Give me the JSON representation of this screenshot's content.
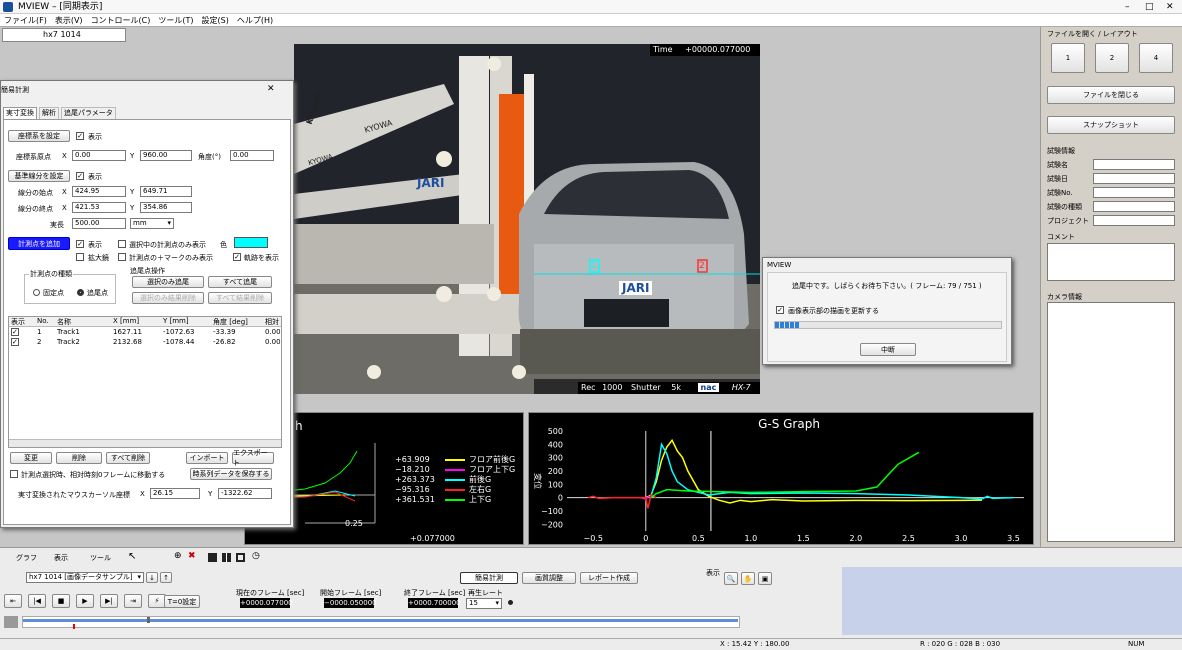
{
  "window": {
    "app": "MVIEW",
    "title": "MVIEW  –  [同期表示]",
    "min": "–",
    "max": "□",
    "close": "✕"
  },
  "menu": [
    "ファイル(F)",
    "表示(V)",
    "コントロール(C)",
    "ツール(T)",
    "設定(S)",
    "ヘルプ(H)"
  ],
  "tab": {
    "label": "hx7 1014"
  },
  "video": {
    "time_label": "Time",
    "time_value": "+00000.077000",
    "rec_label": "Rec",
    "rec_value": "1000",
    "shutter_label": "Shutter",
    "shutter_value": "5k",
    "brand": "nac",
    "model": "HX-7",
    "track_markers": [
      "1",
      "2"
    ],
    "plate": "JARI",
    "sign": "JARI",
    "kyowa": "KYOWA",
    "kyowa2": "KYOWA",
    "kyowa3": "KYOWA"
  },
  "right_panel": {
    "open_layout_title": "ファイルを開く / レイアウト",
    "layout_buttons": [
      "1",
      "2",
      "4"
    ],
    "close_file": "ファイルを閉じる",
    "snapshot": "スナップショット",
    "test_info_title": "試験情報",
    "test_info_fields": [
      "試験名",
      "試験日",
      "試験No.",
      "試験の種類",
      "プロジェクト"
    ],
    "comment": "コメント",
    "camera_info_title": "カメラ情報"
  },
  "progress_dialog": {
    "title": "MVIEW",
    "message": "追尾中です。しばらくお待ち下さい。( フレーム: 79 / 751 )",
    "checkbox": "画像表示部の描画を更新する",
    "checked": "✓",
    "cancel": "中断",
    "progress": 0.105
  },
  "measure_panel": {
    "title": "簡易計測",
    "close": "✕",
    "tabs": [
      "実寸変換",
      "解析",
      "追尾パラメータ"
    ],
    "coord_btn": "座標系を設定",
    "show": "表示",
    "origin_label": "座標系原点",
    "x": "X",
    "y": "Y",
    "origin_x": "0.00",
    "origin_y": "960.00",
    "angle_label": "角度(°)",
    "angle": "0.00",
    "ref_btn": "基準線分を設定",
    "seg_start": "線分の始点",
    "seg_start_x": "424.95",
    "seg_start_y": "649.71",
    "seg_end": "線分の終点",
    "seg_end_x": "421.53",
    "seg_end_y": "354.86",
    "length_label": "実長",
    "length": "500.00",
    "unit": "mm",
    "add_point_btn": "計測点を追加",
    "sel_only": "選択中の計測点のみ表示",
    "color_label": "色",
    "magnifier": "拡大鏡",
    "mark_only": "計測点の＋マークのみ表示",
    "show_track": "軌跡を表示",
    "point_type_title": "計測点の種類",
    "fixed": "固定点",
    "tracking": "追尾点",
    "track_ops_title": "追尾点操作",
    "track_selected": "選択のみ追尾",
    "track_all": "すべて追尾",
    "del_selected": "選択のみ結果削除",
    "del_all": "すべて結果削除",
    "table_headers": [
      "表示",
      "No.",
      "名称",
      "X [mm]",
      "Y [mm]",
      "角度 [deg]",
      "相対"
    ],
    "rows": [
      {
        "show": "✓",
        "no": "1",
        "name": "Track1",
        "x": "1627.11",
        "y": "-1072.63",
        "angle": "-33.39",
        "rel": "0.000"
      },
      {
        "show": "✓",
        "no": "2",
        "name": "Track2",
        "x": "2132.68",
        "y": "-1078.44",
        "angle": "-26.82",
        "rel": "0.000"
      }
    ],
    "change": "変更",
    "delete": "削除",
    "delete_all": "すべて削除",
    "import": "インポート",
    "export": "エクスポート",
    "move_frame": "計測点選択時、相対時刻0フレームに移動する",
    "save_series": "時系列データを保存する",
    "cursor_label": "実寸変換されたマウスカーソル座標",
    "cursor_x": "26.15",
    "cursor_y": "-1322.62"
  },
  "graph_left": {
    "title": "h",
    "xticks": [
      "0.25"
    ],
    "time": "+0.077000",
    "legend": [
      {
        "value": "+63.909",
        "name": "フロア前後G",
        "color": "#ffff00"
      },
      {
        "value": "−18.210",
        "name": "フロア上下G",
        "color": "#ff00ff"
      },
      {
        "value": "+263.373",
        "name": "前後G",
        "color": "#00ffff"
      },
      {
        "value": "−95.316",
        "name": "左右G",
        "color": "#ff2020"
      },
      {
        "value": "+361.531",
        "name": "上下G",
        "color": "#00ff00"
      }
    ]
  },
  "chart_data": {
    "type": "line",
    "title": "G-S Graph",
    "xlim": [
      -0.75,
      3.6
    ],
    "ylim": [
      -250,
      500
    ],
    "xticks": [
      "−0.5",
      "0",
      "0.5",
      "1.0",
      "1.5",
      "2.0",
      "2.5",
      "3.0",
      "3.5"
    ],
    "yticks": [
      "500",
      "400",
      "300",
      "200",
      "100",
      "0",
      "−100",
      "−200"
    ],
    "ylabel": "変位",
    "cursor_x": 0.62,
    "series": [
      {
        "color": "#ffff00",
        "values": [
          [
            0,
            0
          ],
          [
            0.05,
            20
          ],
          [
            0.1,
            120
          ],
          [
            0.15,
            280
          ],
          [
            0.2,
            380
          ],
          [
            0.25,
            430
          ],
          [
            0.3,
            350
          ],
          [
            0.35,
            300
          ],
          [
            0.4,
            200
          ],
          [
            0.5,
            60
          ],
          [
            0.6,
            10
          ],
          [
            0.7,
            -20
          ],
          [
            0.8,
            -40
          ],
          [
            0.9,
            -20
          ],
          [
            1.0,
            -30
          ],
          [
            1.2,
            -15
          ],
          [
            1.5,
            -25
          ],
          [
            2.0,
            -20
          ],
          [
            2.5,
            -22
          ],
          [
            3.0,
            -20
          ],
          [
            3.2,
            -18
          ]
        ]
      },
      {
        "color": "#ff00ff",
        "values": [
          [
            -0.05,
            0
          ],
          [
            0,
            -10
          ],
          [
            0.03,
            10
          ],
          [
            0.05,
            0
          ]
        ]
      },
      {
        "color": "#00ffff",
        "values": [
          [
            0.05,
            10
          ],
          [
            0.1,
            150
          ],
          [
            0.15,
            400
          ],
          [
            0.2,
            330
          ],
          [
            0.25,
            200
          ],
          [
            0.3,
            120
          ],
          [
            0.4,
            60
          ],
          [
            0.6,
            20
          ],
          [
            0.8,
            40
          ],
          [
            1.0,
            30
          ],
          [
            1.5,
            35
          ],
          [
            2.0,
            30
          ],
          [
            2.5,
            20
          ],
          [
            3.0,
            0
          ],
          [
            3.2,
            -10
          ],
          [
            3.25,
            10
          ],
          [
            3.3,
            -5
          ],
          [
            3.5,
            0
          ]
        ]
      },
      {
        "color": "#ff2020",
        "values": [
          [
            -0.55,
            0
          ],
          [
            -0.5,
            10
          ],
          [
            -0.45,
            -5
          ],
          [
            -0.3,
            0
          ],
          [
            0,
            0
          ],
          [
            0.02,
            -80
          ],
          [
            0.05,
            20
          ],
          [
            0.1,
            0
          ]
        ]
      },
      {
        "color": "#00ff00",
        "values": [
          [
            0.05,
            0
          ],
          [
            0.1,
            30
          ],
          [
            0.2,
            60
          ],
          [
            0.4,
            50
          ],
          [
            1.0,
            40
          ],
          [
            1.5,
            45
          ],
          [
            2.0,
            50
          ],
          [
            2.2,
            80
          ],
          [
            2.4,
            250
          ],
          [
            2.6,
            340
          ]
        ]
      }
    ]
  },
  "toolbar": {
    "graph": "グラフ",
    "display": "表示",
    "tool": "ツール"
  },
  "playback": {
    "source": "hx7 1014 [画像データサンプル]",
    "measure_btn": "簡易計測",
    "image_adj": "画質調整",
    "report": "レポート作成",
    "display": "表示",
    "current_frame_label": "現在のフレーム [sec]",
    "current_frame": "+0000.077000",
    "start_frame_label": "開始フレーム [sec]",
    "start_frame": "−0000.050000",
    "end_frame_label": "終了フレーム [sec]",
    "end_frame": "+0000.700000",
    "rate_label": "再生レート",
    "rate": "15",
    "t0": "T=0設定"
  },
  "status": {
    "coords": "X : 15.42  Y : 180.00",
    "rgb": "R : 020  G : 028  B : 030",
    "num": "NUM"
  }
}
